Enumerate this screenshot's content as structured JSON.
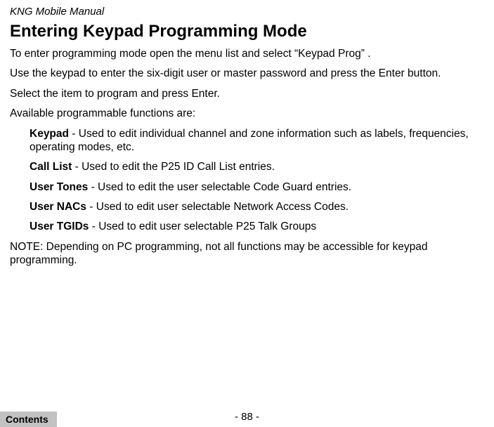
{
  "header": {
    "title": "KNG Mobile Manual"
  },
  "main": {
    "heading": "Entering Keypad Programming Mode",
    "p1": "To enter programming mode open the menu list and select “Keypad Prog” .",
    "p2": "Use the keypad to enter the six-digit user or master password and press the Enter button.",
    "p3": "Select the item to program and press Enter.",
    "p4": "Available programmable functions are:",
    "functions": [
      {
        "name": "Keypad",
        "desc": " - Used to edit individual channel and zone information such as labels, frequencies, operating modes, etc."
      },
      {
        "name": "Call List",
        "desc": " - Used to edit the P25 ID Call List entries."
      },
      {
        "name": "User Tones",
        "desc": " - Used to edit the user selectable Code Guard entries."
      },
      {
        "name": "User NACs",
        "desc": " - Used to edit user selectable Network Access Codes."
      },
      {
        "name": "User TGIDs",
        "desc": " - Used to edit user selectable P25 Talk Groups"
      }
    ],
    "note": "NOTE: Depending on PC programming, not all functions may be accessible for keypad programming."
  },
  "footer": {
    "page_number": "- 88 -",
    "contents_label": "Contents"
  }
}
